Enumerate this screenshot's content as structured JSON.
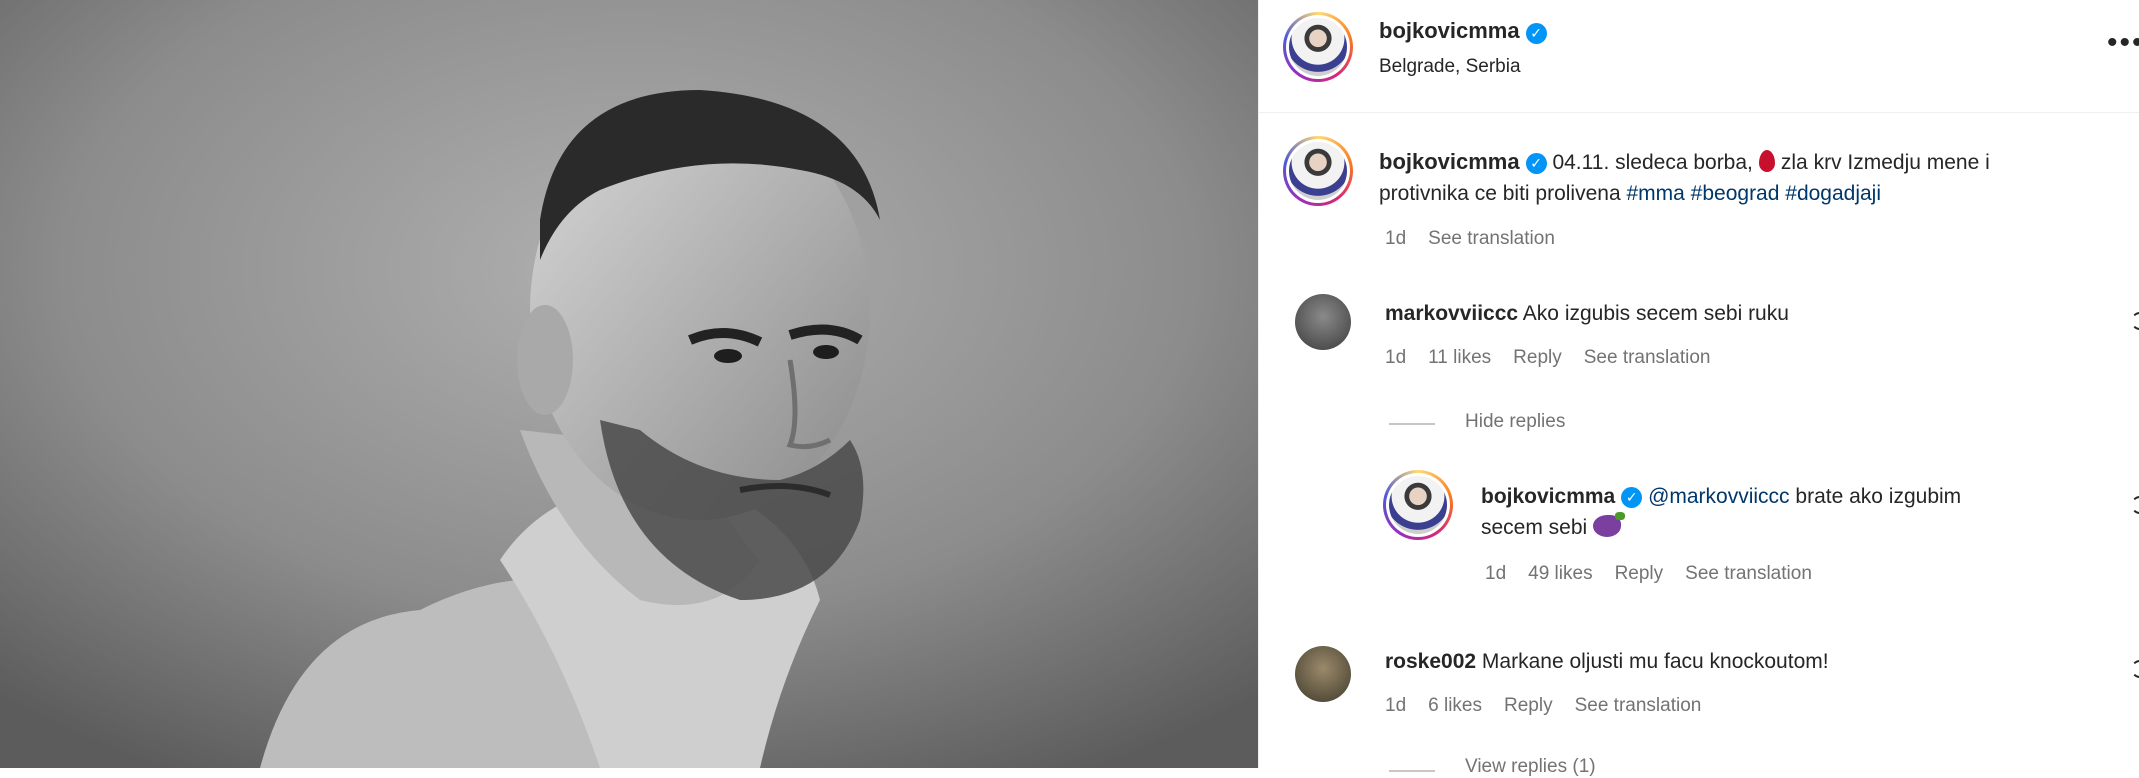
{
  "header": {
    "username": "bojkovicmma",
    "location": "Belgrade, Serbia",
    "more_label": "..."
  },
  "caption": {
    "username": "bojkovicmma",
    "text_before": "04.11. sledeca borba,",
    "emoji": "blood-drop-icon",
    "text_after": "zla krv Izmedju mene i",
    "line2_text": "protivnika ce biti prolivena",
    "hashtags": [
      "#mma",
      "#beograd",
      "#dogadjaji"
    ],
    "time": "1d",
    "see_translation": "See translation"
  },
  "comments": [
    {
      "username": "markovviiccc",
      "text": "Ako izgubis secem sebi ruku",
      "time": "1d",
      "likes": "11 likes",
      "reply": "Reply",
      "see_translation": "See translation",
      "hide_replies": "Hide replies",
      "replies": [
        {
          "username": "bojkovicmma",
          "mention": "@markovviiccc",
          "text_line1": "brate ako izgubim",
          "text_line2": "secem sebi",
          "emoji": "eggplant-icon",
          "time": "1d",
          "likes": "49 likes",
          "reply": "Reply",
          "see_translation": "See translation"
        }
      ]
    },
    {
      "username": "roske002",
      "text": "Markane oljusti mu facu knockoutom!",
      "time": "1d",
      "likes": "6 likes",
      "reply": "Reply",
      "see_translation": "See translation",
      "view_replies": "View replies (1)"
    }
  ],
  "colors": {
    "verified": "#0095f6",
    "hashtag": "#00376b",
    "meta": "#737373"
  }
}
